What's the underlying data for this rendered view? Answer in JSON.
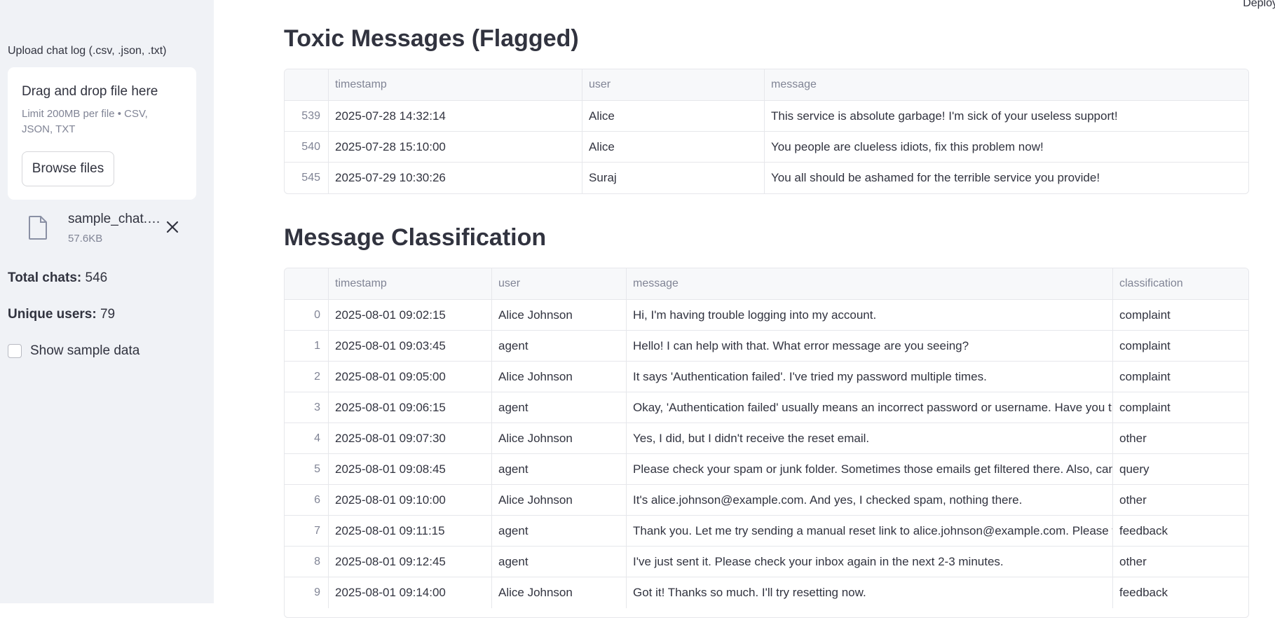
{
  "header": {
    "deploy_label": "Deploy"
  },
  "sidebar": {
    "upload_label": "Upload chat log (.csv, .json, .txt)",
    "dropzone_title": "Drag and drop file here",
    "dropzone_limit": "Limit 200MB per file • CSV, JSON, TXT",
    "browse_label": "Browse files",
    "file": {
      "name": "sample_chat.csv",
      "size": "57.6KB"
    },
    "total_chats_label": "Total chats:",
    "total_chats_value": "546",
    "unique_users_label": "Unique users:",
    "unique_users_value": "79",
    "show_sample_label": "Show sample data",
    "show_sample_checked": false
  },
  "toxic": {
    "title": "Toxic Messages (Flagged)",
    "columns": [
      "",
      "timestamp",
      "user",
      "message"
    ],
    "rows": [
      [
        "539",
        "2025-07-28 14:32:14",
        "Alice",
        "This service is absolute garbage! I'm sick of your useless support!"
      ],
      [
        "540",
        "2025-07-28 15:10:00",
        "Alice",
        "You people are clueless idiots, fix this problem now!"
      ],
      [
        "545",
        "2025-07-29 10:30:26",
        "Suraj",
        "You all should be ashamed for the terrible service you provide!"
      ]
    ]
  },
  "classification": {
    "title": "Message Classification",
    "columns": [
      "",
      "timestamp",
      "user",
      "message",
      "classification"
    ],
    "rows": [
      [
        "0",
        "2025-08-01 09:02:15",
        "Alice Johnson",
        "Hi, I'm having trouble logging into my account.",
        "complaint"
      ],
      [
        "1",
        "2025-08-01 09:03:45",
        "agent",
        "Hello! I can help with that. What error message are you seeing?",
        "complaint"
      ],
      [
        "2",
        "2025-08-01 09:05:00",
        "Alice Johnson",
        "It says 'Authentication failed'. I've tried my password multiple times.",
        "complaint"
      ],
      [
        "3",
        "2025-08-01 09:06:15",
        "agent",
        "Okay, 'Authentication failed' usually means an incorrect password or username. Have you tried",
        "complaint"
      ],
      [
        "4",
        "2025-08-01 09:07:30",
        "Alice Johnson",
        "Yes, I did, but I didn't receive the reset email.",
        "other"
      ],
      [
        "5",
        "2025-08-01 09:08:45",
        "agent",
        "Please check your spam or junk folder. Sometimes those emails get filtered there. Also, can you",
        "query"
      ],
      [
        "6",
        "2025-08-01 09:10:00",
        "Alice Johnson",
        "It's alice.johnson@example.com. And yes, I checked spam, nothing there.",
        "other"
      ],
      [
        "7",
        "2025-08-01 09:11:15",
        "agent",
        "Thank you. Let me try sending a manual reset link to alice.johnson@example.com. Please wait",
        "feedback"
      ],
      [
        "8",
        "2025-08-01 09:12:45",
        "agent",
        "I've just sent it. Please check your inbox again in the next 2-3 minutes.",
        "other"
      ],
      [
        "9",
        "2025-08-01 09:14:00",
        "Alice Johnson",
        "Got it! Thanks so much. I'll try resetting now.",
        "feedback"
      ]
    ]
  }
}
